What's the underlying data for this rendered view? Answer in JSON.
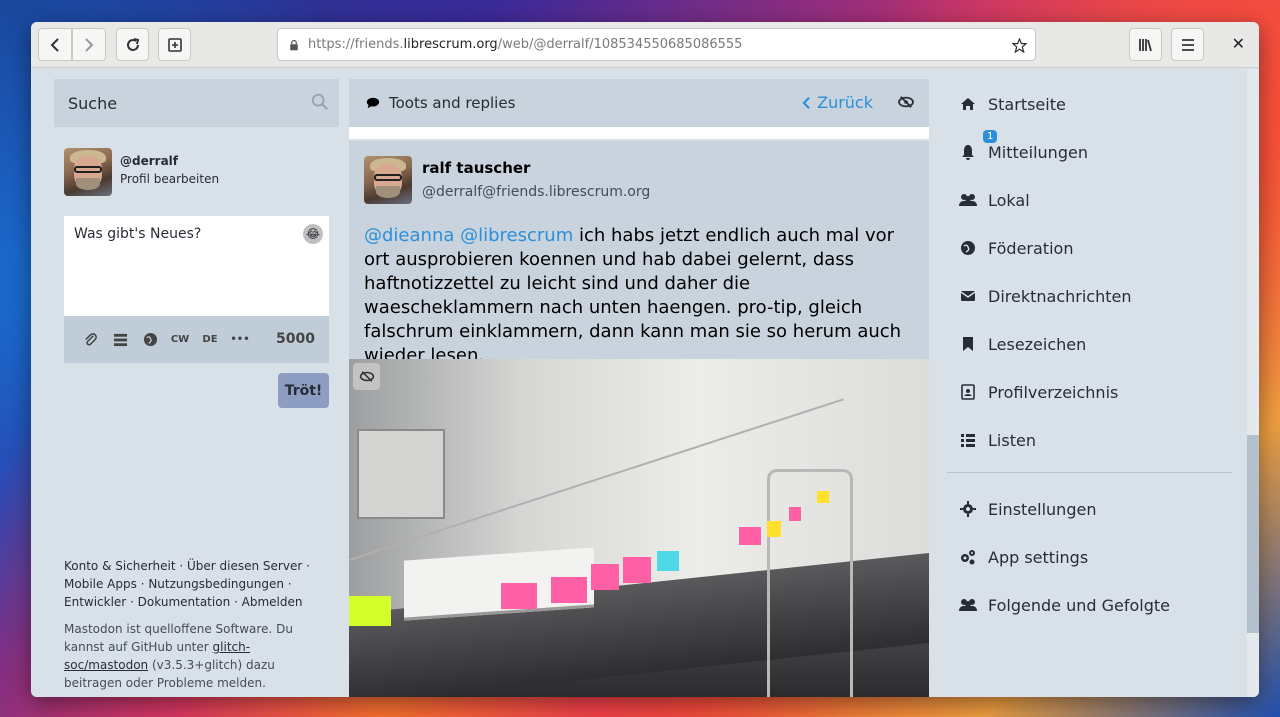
{
  "browser": {
    "url_prefix": "https://friends.",
    "url_domain": "librescrum.org",
    "url_path": "/web/@derralf/108534550685086555"
  },
  "left": {
    "search_placeholder": "Suche",
    "profile_handle": "@derralf",
    "profile_edit": "Profil bearbeiten",
    "compose_placeholder": "Was gibt's Neues?",
    "cw_label": "CW",
    "lang_label": "DE",
    "char_count": "5000",
    "toot_button": "Tröt!",
    "footer_line1": "Konto & Sicherheit · Über diesen Server ·",
    "footer_line2": "Mobile Apps · Nutzungsbedingungen ·",
    "footer_line3": "Entwickler · Dokumentation · Abmelden",
    "about_text1": "Mastodon ist quelloffene Software. Du kannst auf GitHub unter ",
    "about_link": "glitch-soc/mastodon",
    "about_text2": " (v3.5.3+glitch) dazu beitragen oder Probleme melden."
  },
  "middle": {
    "header_title": "Toots and replies",
    "back_label": "Zurück",
    "status": {
      "display_name": "ralf tauscher",
      "account": "@derralf@friends.librescrum.org",
      "mention1": "@dieanna",
      "mention2": "@librescrum",
      "text": " ich habs jetzt endlich auch mal vor ort ausprobieren koennen und hab dabei gelernt, dass haftnotizzettel zu leicht sind und daher die waescheklammern nach unten haengen. pro-tip, gleich falschrum einklammern, dann kann man sie so herum auch wieder lesen."
    }
  },
  "nav": {
    "items": [
      {
        "label": "Startseite",
        "icon": "home-icon"
      },
      {
        "label": "Mitteilungen",
        "icon": "bell-icon",
        "badge": "1"
      },
      {
        "label": "Lokal",
        "icon": "users-icon"
      },
      {
        "label": "Föderation",
        "icon": "globe-icon"
      },
      {
        "label": "Direktnachrichten",
        "icon": "envelope-icon"
      },
      {
        "label": "Lesezeichen",
        "icon": "bookmark-icon"
      },
      {
        "label": "Profilverzeichnis",
        "icon": "address-book-icon"
      },
      {
        "label": "Listen",
        "icon": "list-icon"
      },
      {
        "label": "Einstellungen",
        "icon": "cog-icon"
      },
      {
        "label": "App settings",
        "icon": "cogs-icon"
      },
      {
        "label": "Folgende und Gefolgte",
        "icon": "users-icon"
      }
    ]
  },
  "colors": {
    "accent": "#2b90d9",
    "background": "#d9e1e8",
    "header": "#c8d3dd",
    "button": "#8d9ec2"
  }
}
